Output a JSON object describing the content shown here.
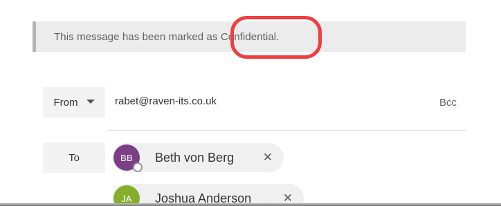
{
  "banner": {
    "text": "This message has been marked as Confidential."
  },
  "highlight": {
    "color": "#ef3e42"
  },
  "from": {
    "label": "From",
    "address": "rabet@raven-its.co.uk",
    "bcc_label": "Bcc",
    "caret_icon": "chevron-down-icon"
  },
  "to": {
    "label": "To",
    "recipients": [
      {
        "initials": "BB",
        "name": "Beth von Berg",
        "avatar_color": "#7b3f86",
        "remove_label": "✕"
      },
      {
        "initials": "JA",
        "name": "Joshua Anderson",
        "avatar_color": "#86ad2c",
        "remove_label": "✕"
      }
    ]
  }
}
